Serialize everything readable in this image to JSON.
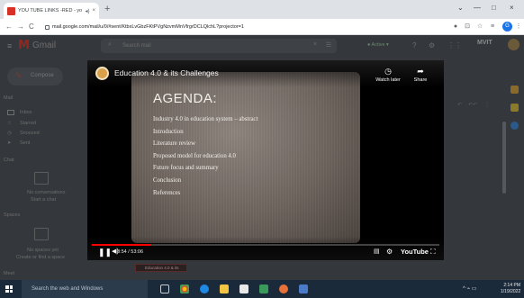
{
  "browser": {
    "tab_title": "YOU TUBE LINKS -RED - yo",
    "tab_audio_icon": "speaker-icon",
    "new_tab": "+",
    "url": "mail.google.com/mail/u/0/#sent/KtbxLvGbzFKtPVgNzvmMnVfrgrDCLQlchL?projector=1",
    "back": "←",
    "forward": "→",
    "reload": "C",
    "minimize": "—",
    "maximize": "□",
    "close": "×",
    "profile_letter": "G"
  },
  "gmail": {
    "product": "Gmail",
    "search_placeholder": "Search mail",
    "status": "● Active ▾",
    "account_label": "MVIT",
    "compose": "Compose",
    "nav_mail": "Mail",
    "nav_items": [
      "Inbox",
      "Starred",
      "Snoozed",
      "Sent",
      "Drafts"
    ],
    "nav_chat": "Chat",
    "nav_spaces": "Spaces",
    "nav_meet": "Meet",
    "chat_empty": "No conversations",
    "chat_start": "Start a chat",
    "spaces_empty": "No spaces yet",
    "spaces_link": "Create or find a space"
  },
  "video": {
    "title": "Education 4.0 & its Challenges",
    "watch_later": "Watch later",
    "share": "Share",
    "current_time": "8:54 / 53:06",
    "brand": "YouTube",
    "progress_fraction": 0.17,
    "thumb_label": "Education 4.0 & its",
    "slide": {
      "heading": "AGENDA:",
      "items": [
        "Industry 4.0 in education system – abstract",
        "Introduction",
        "Literature review",
        "Proposed model  for education 4.0",
        "Future focus and summary",
        "Conclusion",
        "References"
      ]
    }
  },
  "taskbar": {
    "search_placeholder": "Search the web and Windows",
    "time": "2:14 PM",
    "date": "1/19/2022",
    "tray": "^  ⌁  ▭"
  }
}
